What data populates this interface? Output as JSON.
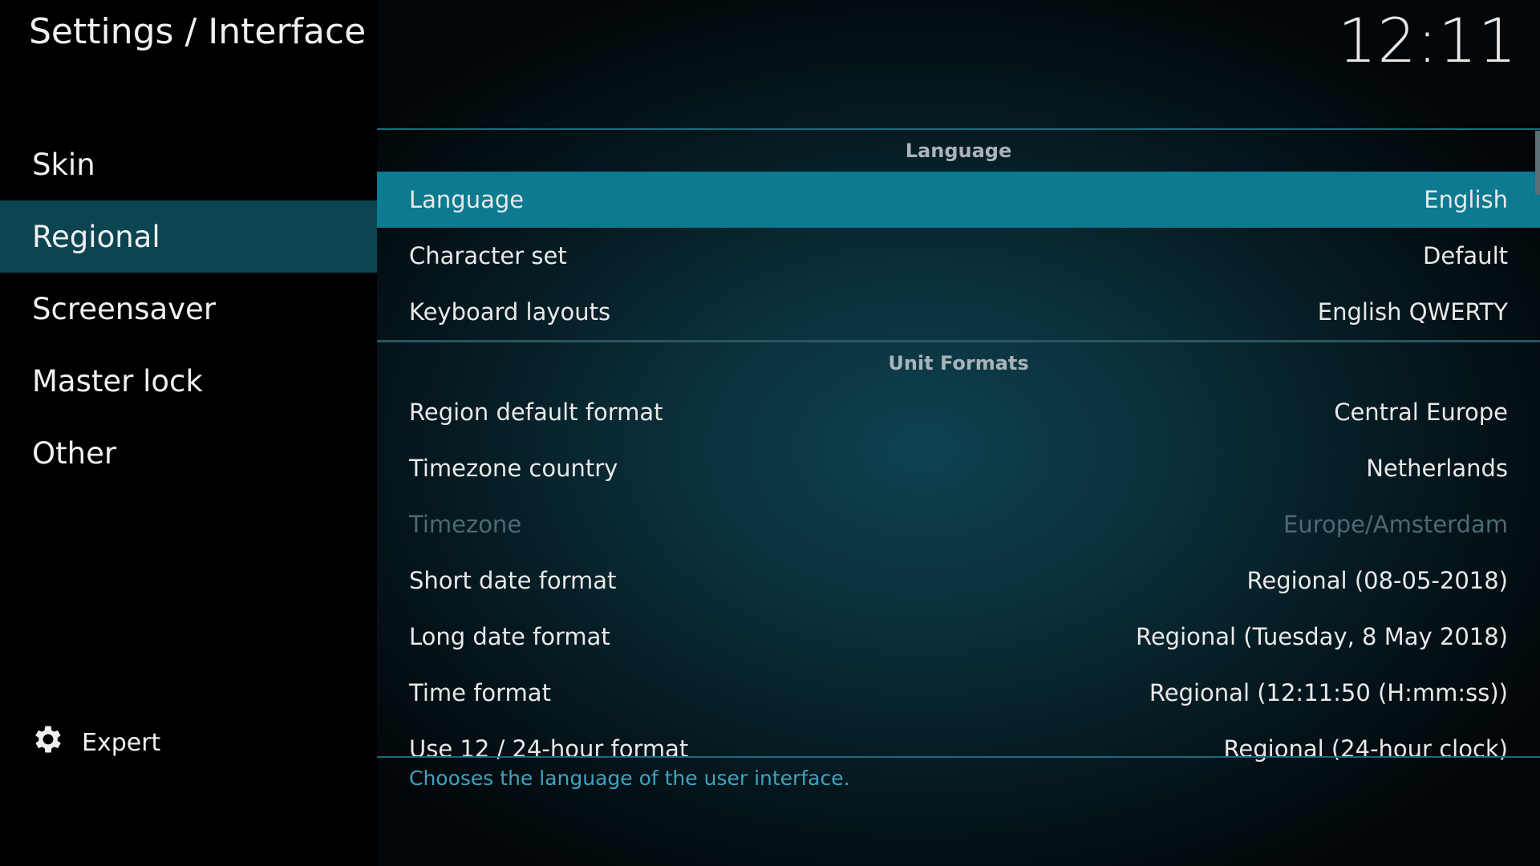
{
  "header": {
    "title": "Settings / Interface",
    "clock": "12:11"
  },
  "sidebar": {
    "items": [
      {
        "label": "Skin"
      },
      {
        "label": "Regional"
      },
      {
        "label": "Screensaver"
      },
      {
        "label": "Master lock"
      },
      {
        "label": "Other"
      }
    ],
    "active_index": 1,
    "expert_label": "Expert"
  },
  "sections": [
    {
      "title": "Language",
      "rows": [
        {
          "label": "Language",
          "value": "English"
        },
        {
          "label": "Character set",
          "value": "Default"
        },
        {
          "label": "Keyboard layouts",
          "value": "English QWERTY"
        }
      ]
    },
    {
      "title": "Unit Formats",
      "rows": [
        {
          "label": "Region default format",
          "value": "Central Europe"
        },
        {
          "label": "Timezone country",
          "value": "Netherlands"
        },
        {
          "label": "Timezone",
          "value": "Europe/Amsterdam"
        },
        {
          "label": "Short date format",
          "value": "Regional (08-05-2018)"
        },
        {
          "label": "Long date format",
          "value": "Regional (Tuesday, 8 May 2018)"
        },
        {
          "label": "Time format",
          "value": "Regional (12:11:50 (H:mm:ss))"
        },
        {
          "label": "Use 12 / 24-hour format",
          "value": "Regional (24-hour clock)"
        }
      ]
    }
  ],
  "hint": "Chooses the language of the user interface.",
  "colors": {
    "selected_row": "#0c7a91",
    "active_nav": "#0b4552",
    "hint_text": "#3ea4c1"
  }
}
